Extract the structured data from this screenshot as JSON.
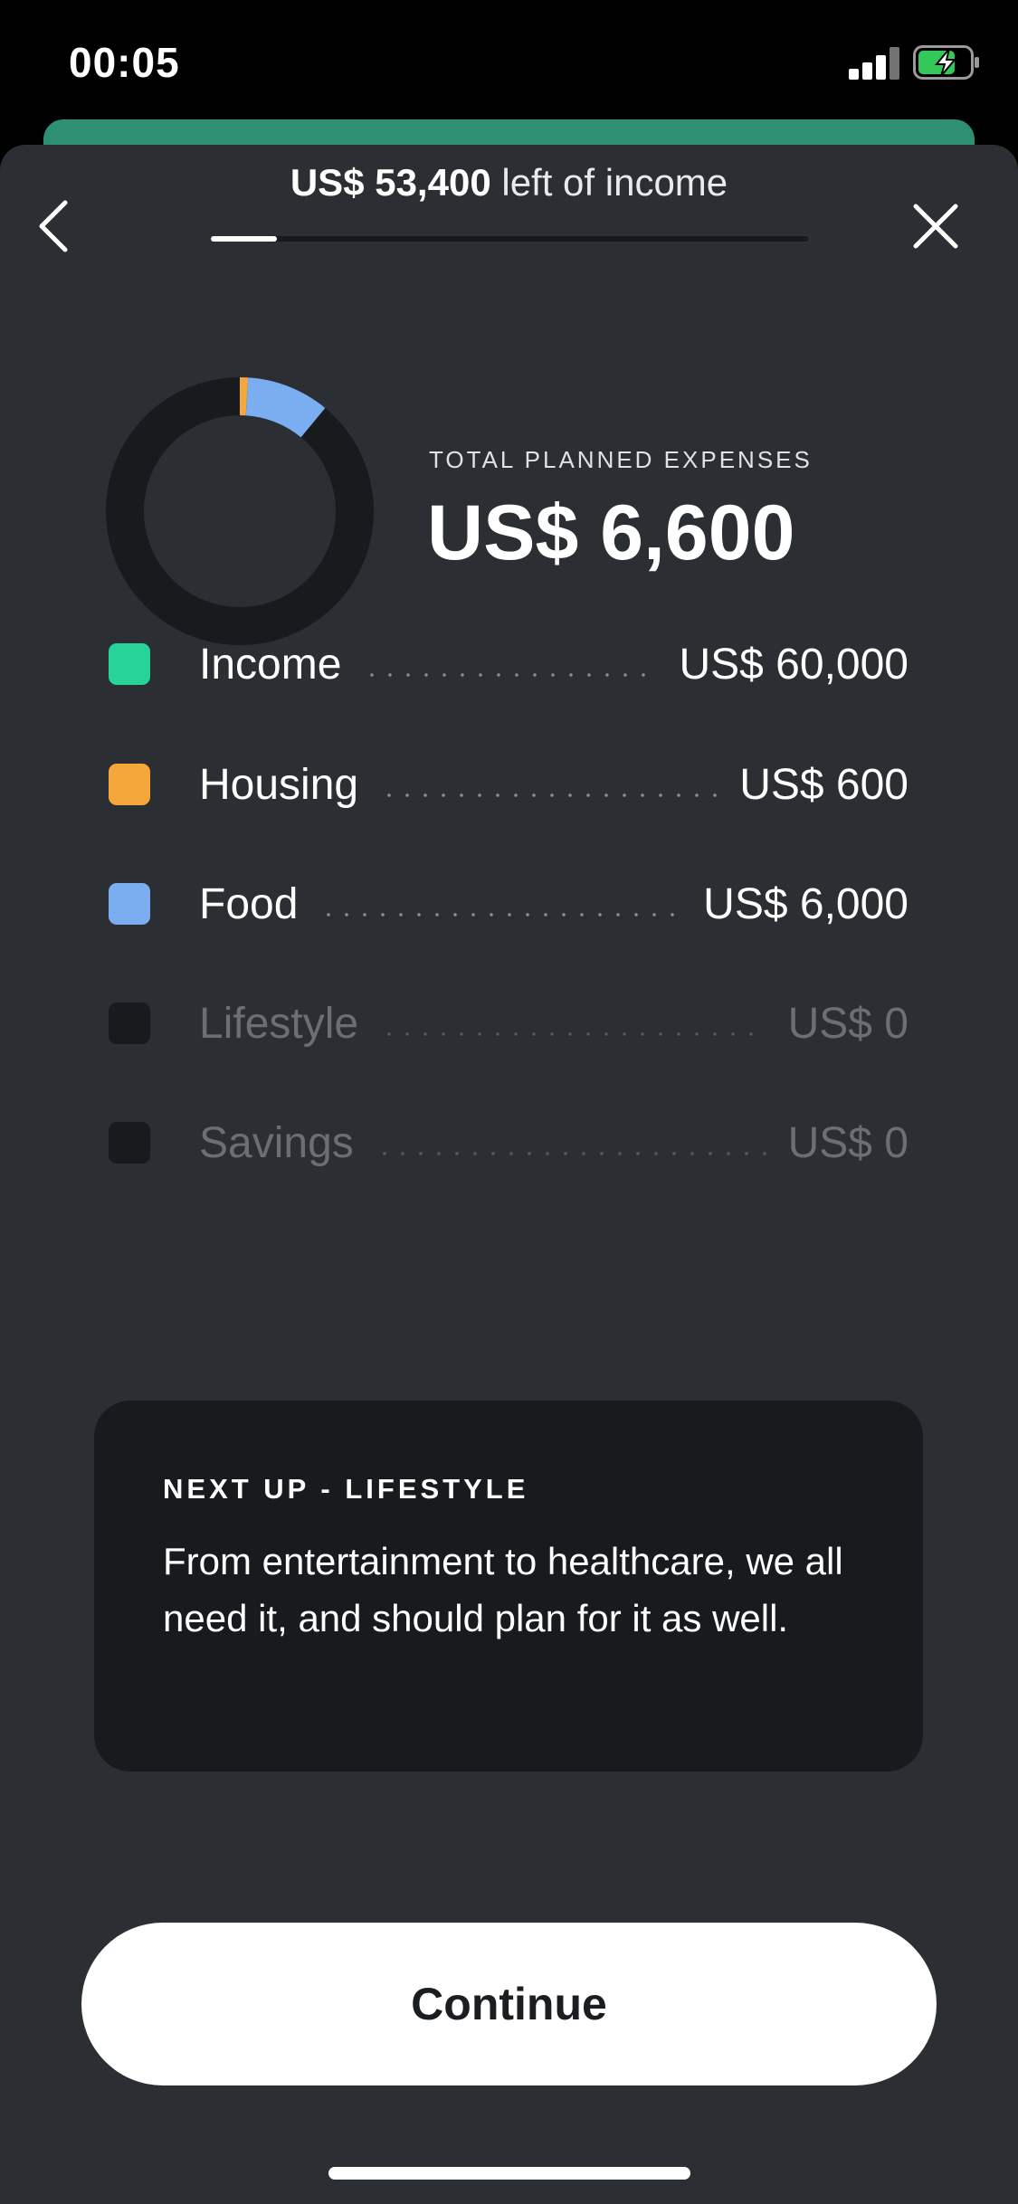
{
  "status_bar": {
    "time": "00:05"
  },
  "header": {
    "amount_left": "US$ 53,400",
    "amount_left_suffix": " left of income",
    "progress": 0.11
  },
  "summary": {
    "label": "TOTAL PLANNED EXPENSES",
    "value": "US$ 6,600",
    "donut_slices": [
      {
        "category": "Housing",
        "amount": 600,
        "color": "#f5a73b"
      },
      {
        "category": "Food",
        "amount": 6000,
        "color": "#7aaef0"
      }
    ],
    "donut_total": 60000,
    "donut_track_color": "#171b1e"
  },
  "legend": [
    {
      "label": "Income",
      "value": "US$ 60,000",
      "color": "#28d39a"
    },
    {
      "label": "Housing",
      "value": "US$ 600",
      "color": "#f5a73b"
    },
    {
      "label": "Food",
      "value": "US$ 6,000",
      "color": "#7aaef0"
    },
    {
      "label": "Lifestyle",
      "value": "US$ 0",
      "color": "#171b1e"
    },
    {
      "label": "Savings",
      "value": "US$ 0",
      "color": "#171b1e"
    }
  ],
  "next_up": {
    "title": "NEXT UP - LIFESTYLE",
    "body": "From entertainment to healthcare, we all need it, and should plan for it as well."
  },
  "continue_label": "Continue",
  "icons": {
    "back": "chevron-left-icon",
    "close": "close-icon",
    "signal": "cellular-signal-icon",
    "battery": "battery-charging-icon"
  }
}
